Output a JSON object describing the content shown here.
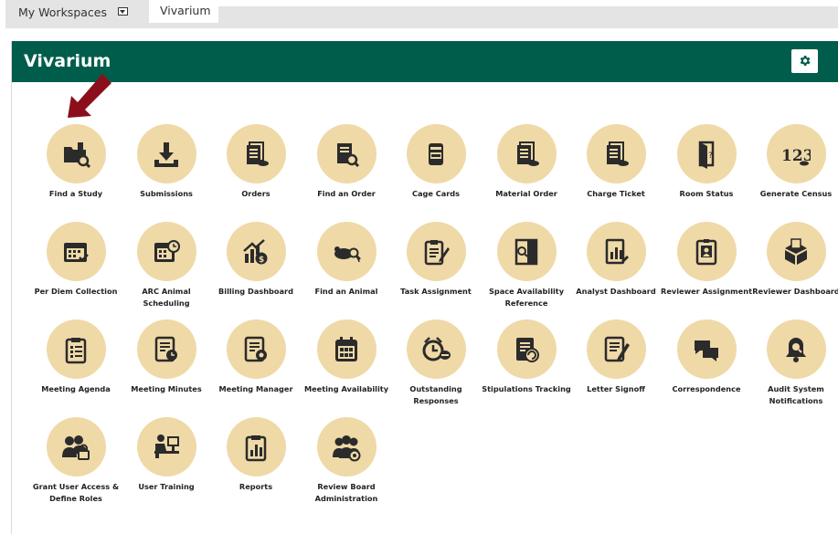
{
  "tabs": {
    "workspaces": "My Workspaces",
    "vivarium": "Vivarium"
  },
  "panel": {
    "title": "Vivarium"
  },
  "tiles": [
    {
      "label": "Find a Study",
      "icon": "folder-search-icon"
    },
    {
      "label": "Submissions",
      "icon": "download-icon"
    },
    {
      "label": "Orders",
      "icon": "documents-icon"
    },
    {
      "label": "Find an Order",
      "icon": "document-search-icon"
    },
    {
      "label": "Cage Cards",
      "icon": "cage-card-icon"
    },
    {
      "label": "Material Order",
      "icon": "documents-icon"
    },
    {
      "label": "Charge Ticket",
      "icon": "documents-icon"
    },
    {
      "label": "Room Status",
      "icon": "door-question-icon"
    },
    {
      "label": "Generate Census",
      "icon": "census-123-icon"
    },
    {
      "label": "Per Diem Collection",
      "icon": "calendar-check-icon"
    },
    {
      "label": "ARC Animal Scheduling",
      "icon": "calendar-clock-icon"
    },
    {
      "label": "Billing Dashboard",
      "icon": "chart-dollar-icon"
    },
    {
      "label": "Find an Animal",
      "icon": "mouse-search-icon"
    },
    {
      "label": "Task Assignment",
      "icon": "clipboard-pencil-icon"
    },
    {
      "label": "Space Availability Reference",
      "icon": "door-search-icon"
    },
    {
      "label": "Analyst Dashboard",
      "icon": "chart-document-icon"
    },
    {
      "label": "Reviewer Assignment",
      "icon": "badge-person-icon"
    },
    {
      "label": "Reviewer Dashboard",
      "icon": "box-documents-icon"
    },
    {
      "label": "Meeting Agenda",
      "icon": "clipboard-list-icon"
    },
    {
      "label": "Meeting Minutes",
      "icon": "document-clock-icon"
    },
    {
      "label": "Meeting Manager",
      "icon": "document-gear-icon"
    },
    {
      "label": "Meeting Availability",
      "icon": "calendar-icon"
    },
    {
      "label": "Outstanding Responses",
      "icon": "alarm-clock-icon"
    },
    {
      "label": "Stipulations Tracking",
      "icon": "document-refresh-icon"
    },
    {
      "label": "Letter Signoff",
      "icon": "document-pen-icon"
    },
    {
      "label": "Correspondence",
      "icon": "chat-bubbles-icon"
    },
    {
      "label": "Audit System Notifications",
      "icon": "bell-search-icon"
    },
    {
      "label": "Grant User Access & Define Roles",
      "icon": "users-lock-icon"
    },
    {
      "label": "User Training",
      "icon": "person-computer-icon"
    },
    {
      "label": "Reports",
      "icon": "clipboard-chart-icon"
    },
    {
      "label": "Review Board Administration",
      "icon": "users-gear-icon"
    }
  ],
  "colors": {
    "header": "#005d4b",
    "tile_circle": "#efd9a7",
    "arrow": "#8b0e1a"
  }
}
